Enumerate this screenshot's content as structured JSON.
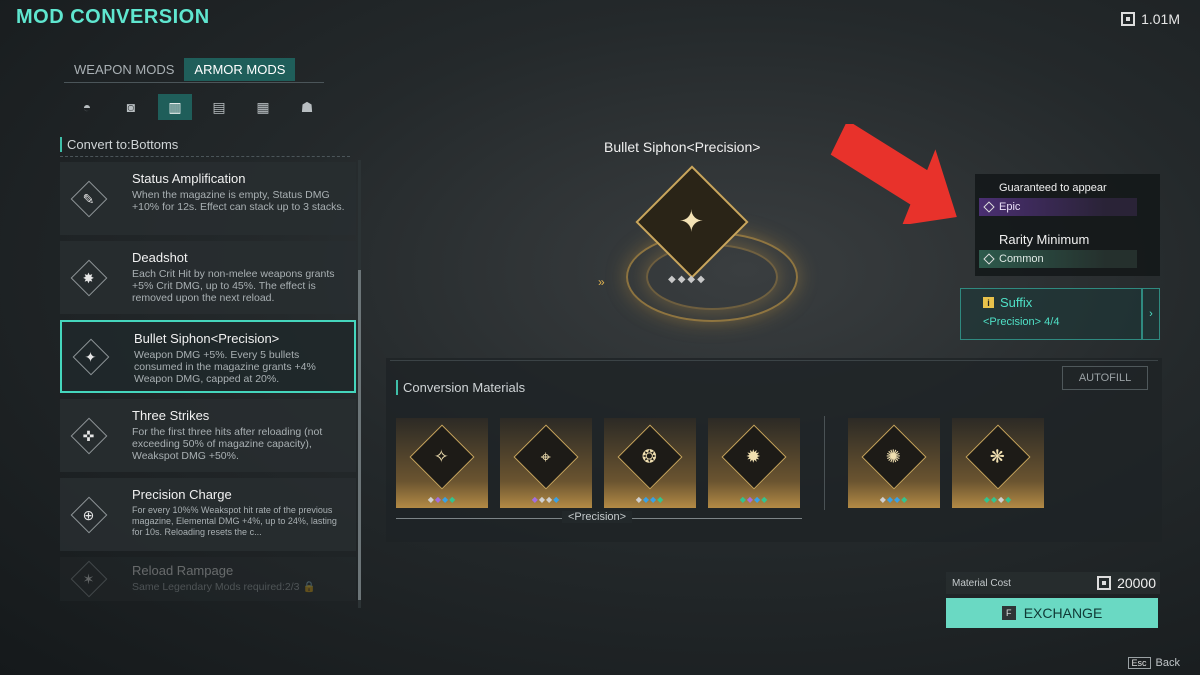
{
  "header": {
    "title": "MOD CONVERSION",
    "currency": "1.01M"
  },
  "tabs": [
    {
      "label": "WEAPON MODS",
      "active": false
    },
    {
      "label": "ARMOR MODS",
      "active": true
    }
  ],
  "slots": [
    {
      "icon": "helmet-icon",
      "glyph": "◓",
      "active": false
    },
    {
      "icon": "chest-armor-icon",
      "glyph": "◙",
      "active": false
    },
    {
      "icon": "bottoms-icon",
      "glyph": "▥",
      "active": true
    },
    {
      "icon": "gloves-icon",
      "glyph": "▤",
      "active": false
    },
    {
      "icon": "boots-icon",
      "glyph": "▦",
      "active": false
    },
    {
      "icon": "mask-icon",
      "glyph": "☗",
      "active": false
    }
  ],
  "convert_title": "Convert to:Bottoms",
  "mods": [
    {
      "name": "Status Amplification",
      "desc": "When the magazine is empty, Status DMG +10% for 12s. Effect can stack up to 3 stacks.",
      "glyph": "✎"
    },
    {
      "name": "Deadshot",
      "desc": "Each Crit Hit by non-melee weapons grants +5% Crit DMG, up to 45%. The effect is removed upon the next reload.",
      "glyph": "✸"
    },
    {
      "name": "Bullet Siphon<Precision>",
      "desc": "Weapon DMG +5%. Every 5 bullets consumed in the magazine grants +4% Weapon DMG, capped at 20%.",
      "glyph": "✦"
    },
    {
      "name": "Three Strikes",
      "desc": "For the first three hits after reloading (not exceeding 50% of magazine capacity), Weakspot DMG +50%.",
      "glyph": "✜"
    },
    {
      "name": "Precision Charge",
      "desc": "For every 10%% Weakspot hit rate of the previous magazine, Elemental DMG +4%, up to 24%, lasting for 10s. Reloading resets the c...",
      "glyph": "⊕"
    },
    {
      "name": "Reload Rampage",
      "desc": "Same Legendary Mods required:2/3",
      "glyph": "✶"
    }
  ],
  "showcase": {
    "title": "Bullet Siphon<Precision>",
    "glyph": "✦",
    "pips": "◆◆◆◆"
  },
  "rarity": {
    "guaranteed_label": "Guaranteed to appear",
    "guaranteed_value": "Epic",
    "minimum_label": "Rarity Minimum",
    "minimum_value": "Common"
  },
  "suffix": {
    "label": "Suffix",
    "value": "<Precision>  4/4"
  },
  "materials": {
    "title": "Conversion Materials",
    "autofill": "AUTOFILL",
    "group_label": "<Precision>",
    "items": [
      {
        "icon": "pistol-mod-icon",
        "glyph": "✧"
      },
      {
        "icon": "sniper-mod-icon",
        "glyph": "⌖"
      },
      {
        "icon": "swirl-mod-icon",
        "glyph": "❂"
      },
      {
        "icon": "burst-mod-icon",
        "glyph": "✹"
      },
      {
        "icon": "ammo-burst-mod-icon",
        "glyph": "✺"
      },
      {
        "icon": "star-circle-mod-icon",
        "glyph": "❋"
      }
    ]
  },
  "cost": {
    "label": "Material Cost",
    "value": "20000"
  },
  "exchange": {
    "key": "F",
    "label": "EXCHANGE"
  },
  "back": {
    "key": "Esc",
    "label": "Back"
  },
  "colors": {
    "accent": "#5fe6cf",
    "epic": "#4a2f72",
    "common": "#2d5a4c",
    "gold": "#c9a65d",
    "arrow": "#e8322b"
  }
}
